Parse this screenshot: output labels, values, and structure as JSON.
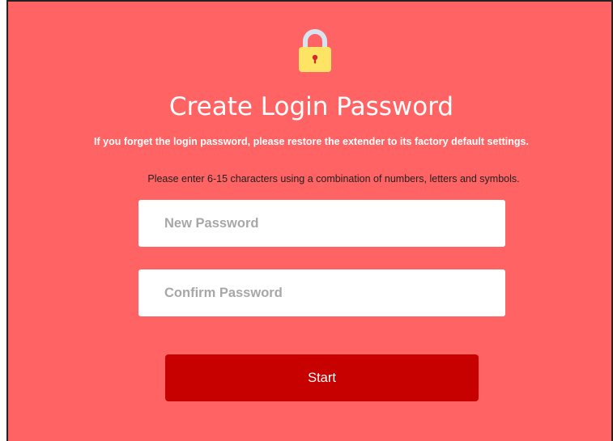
{
  "page": {
    "icon": "padlock-icon",
    "title": "Create Login Password",
    "warning": "If you forget the login password, please restore the extender to its factory default settings.",
    "hint": "Please enter 6-15 characters using a combination of numbers, letters and symbols."
  },
  "form": {
    "new_password": {
      "placeholder": "New Password",
      "value": ""
    },
    "confirm_password": {
      "placeholder": "Confirm Password",
      "value": ""
    },
    "start_label": "Start"
  },
  "colors": {
    "background": "#ff6363",
    "button": "#c70000",
    "text": "#ffffff"
  }
}
